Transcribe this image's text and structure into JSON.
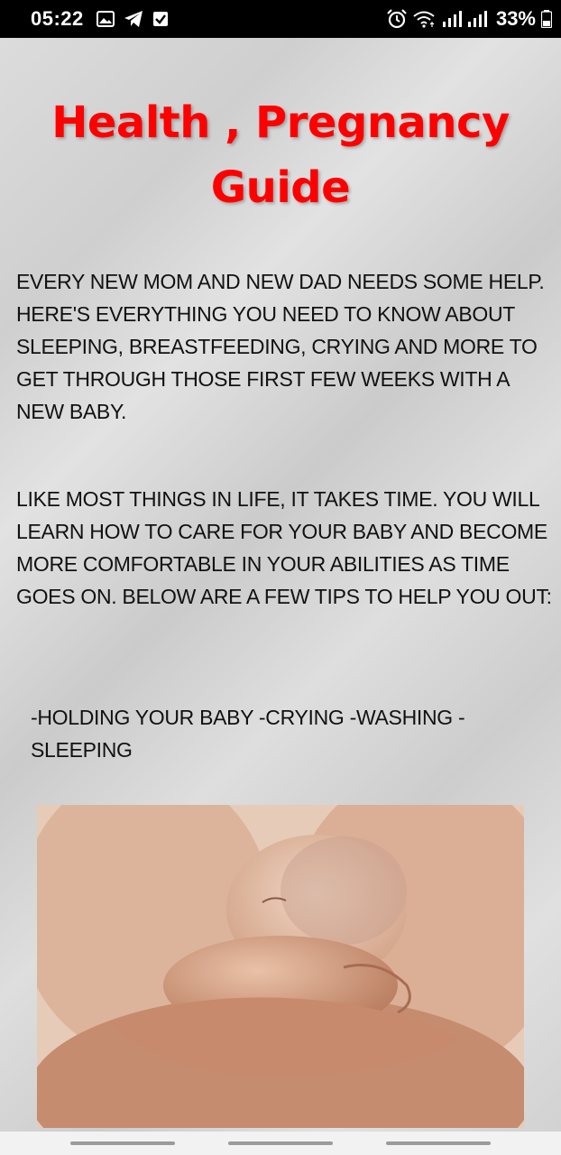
{
  "status_bar": {
    "time": "05:22",
    "battery_percent": "33%",
    "left_icons": [
      "gallery-icon",
      "telegram-icon",
      "checkbox-icon"
    ],
    "right_icons": [
      "alarm-icon",
      "wifi-icon",
      "signal-icon",
      "signal-icon",
      "battery-icon"
    ]
  },
  "page": {
    "title": "Health , Pregnancy Guide",
    "paragraph_1": "EVERY NEW MOM AND NEW DAD NEEDS SOME HELP. HERE'S EVERYTHING YOU NEED TO KNOW ABOUT SLEEPING, BREASTFEEDING,  CRYING AND MORE TO GET THROUGH THOSE FIRST FEW WEEKS WITH A NEW BABY.",
    "paragraph_2": "LIKE MOST THINGS IN LIFE, IT TAKES TIME. YOU WILL LEARN HOW TO CARE FOR YOUR BABY AND BECOME MORE COMFORTABLE IN YOUR ABILITIES AS TIME GOES ON. BELOW ARE A FEW TIPS TO HELP YOU OUT:",
    "tips": "-HOLDING YOUR BABY -CRYING -WASHING -SLEEPING"
  },
  "colors": {
    "title": "#ff0000",
    "body_text": "#111111",
    "background": "#d6d6d6",
    "status_bar": "#000000"
  }
}
